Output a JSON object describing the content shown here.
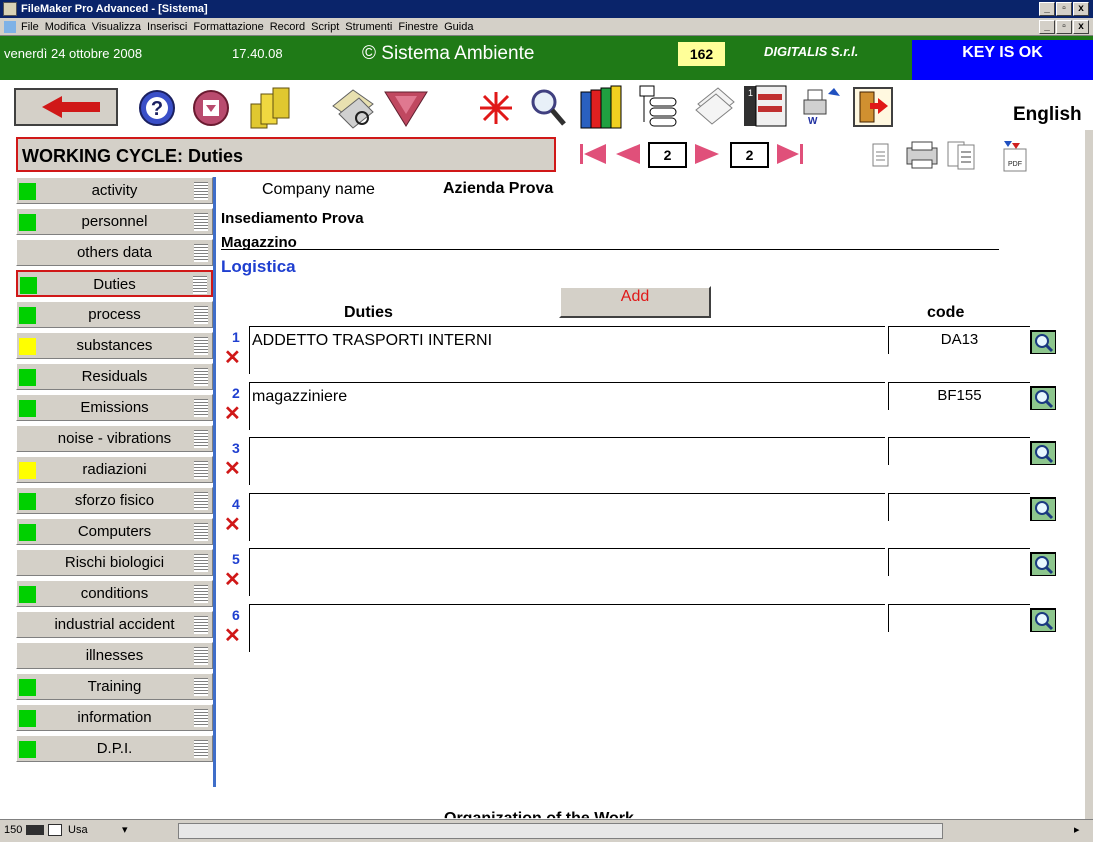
{
  "window": {
    "title": "FileMaker Pro Advanced - [Sistema]",
    "menu": [
      "File",
      "Modifica",
      "Visualizza",
      "Inserisci",
      "Formattazione",
      "Record",
      "Script",
      "Strumenti",
      "Finestre",
      "Guida"
    ]
  },
  "header": {
    "date": "venerdì 24 ottobre 2008",
    "time": "17.40.08",
    "system_name": "© Sistema Ambiente",
    "count": "162",
    "company": "DIGITALIS S.r.l.",
    "key_status": "KEY IS OK",
    "language": "English"
  },
  "toolbar": {
    "icons": [
      "back-arrow-icon",
      "help-icon",
      "download-icon",
      "folders-icon",
      "notes-icon",
      "funnel-icon",
      "asterisk-icon",
      "magnifier-icon",
      "books-icon",
      "list-icon",
      "documents-icon",
      "filmstrip-icon",
      "printer-word-icon",
      "exit-door-icon"
    ]
  },
  "section": {
    "title": "WORKING CYCLE: Duties",
    "page_current": "2",
    "page_total": "2"
  },
  "sidebar": {
    "items": [
      {
        "label": "activity",
        "indicator": "#00d000"
      },
      {
        "label": "personnel",
        "indicator": "#00d000"
      },
      {
        "label": "others data",
        "indicator": ""
      },
      {
        "label": "Duties",
        "indicator": "#00d000",
        "active": true
      },
      {
        "label": "process",
        "indicator": "#00d000"
      },
      {
        "label": "substances",
        "indicator": "#ffff00"
      },
      {
        "label": "Residuals",
        "indicator": "#00d000"
      },
      {
        "label": "Emissions",
        "indicator": "#00d000"
      },
      {
        "label": "noise - vibrations",
        "indicator": ""
      },
      {
        "label": "radiazioni",
        "indicator": "#ffff00"
      },
      {
        "label": "sforzo fisico",
        "indicator": "#00d000"
      },
      {
        "label": "Computers",
        "indicator": "#00d000"
      },
      {
        "label": "Rischi biologici",
        "indicator": ""
      },
      {
        "label": "conditions",
        "indicator": "#00d000"
      },
      {
        "label": "industrial accident",
        "indicator": ""
      },
      {
        "label": "illnesses",
        "indicator": ""
      },
      {
        "label": "Training",
        "indicator": "#00d000"
      },
      {
        "label": "information",
        "indicator": "#00d000"
      },
      {
        "label": "D.P.I.",
        "indicator": "#00d000"
      }
    ]
  },
  "main": {
    "company_label": "Company name",
    "company_value": "Azienda Prova",
    "site": "Insediamento Prova",
    "area": "Magazzino",
    "department": "Logistica",
    "duties_header": "Duties",
    "code_header": "code",
    "add_label": "Add",
    "rows": [
      {
        "num": "1",
        "duty": "ADDETTO TRASPORTI INTERNI",
        "code": "DA13"
      },
      {
        "num": "2",
        "duty": "magazziniere",
        "code": "BF155"
      },
      {
        "num": "3",
        "duty": "",
        "code": ""
      },
      {
        "num": "4",
        "duty": "",
        "code": ""
      },
      {
        "num": "5",
        "duty": "",
        "code": ""
      },
      {
        "num": "6",
        "duty": "",
        "code": ""
      }
    ],
    "cutoff_text": "Organization of the Work"
  },
  "statusbar": {
    "zoom": "150",
    "mode": "Usa"
  }
}
